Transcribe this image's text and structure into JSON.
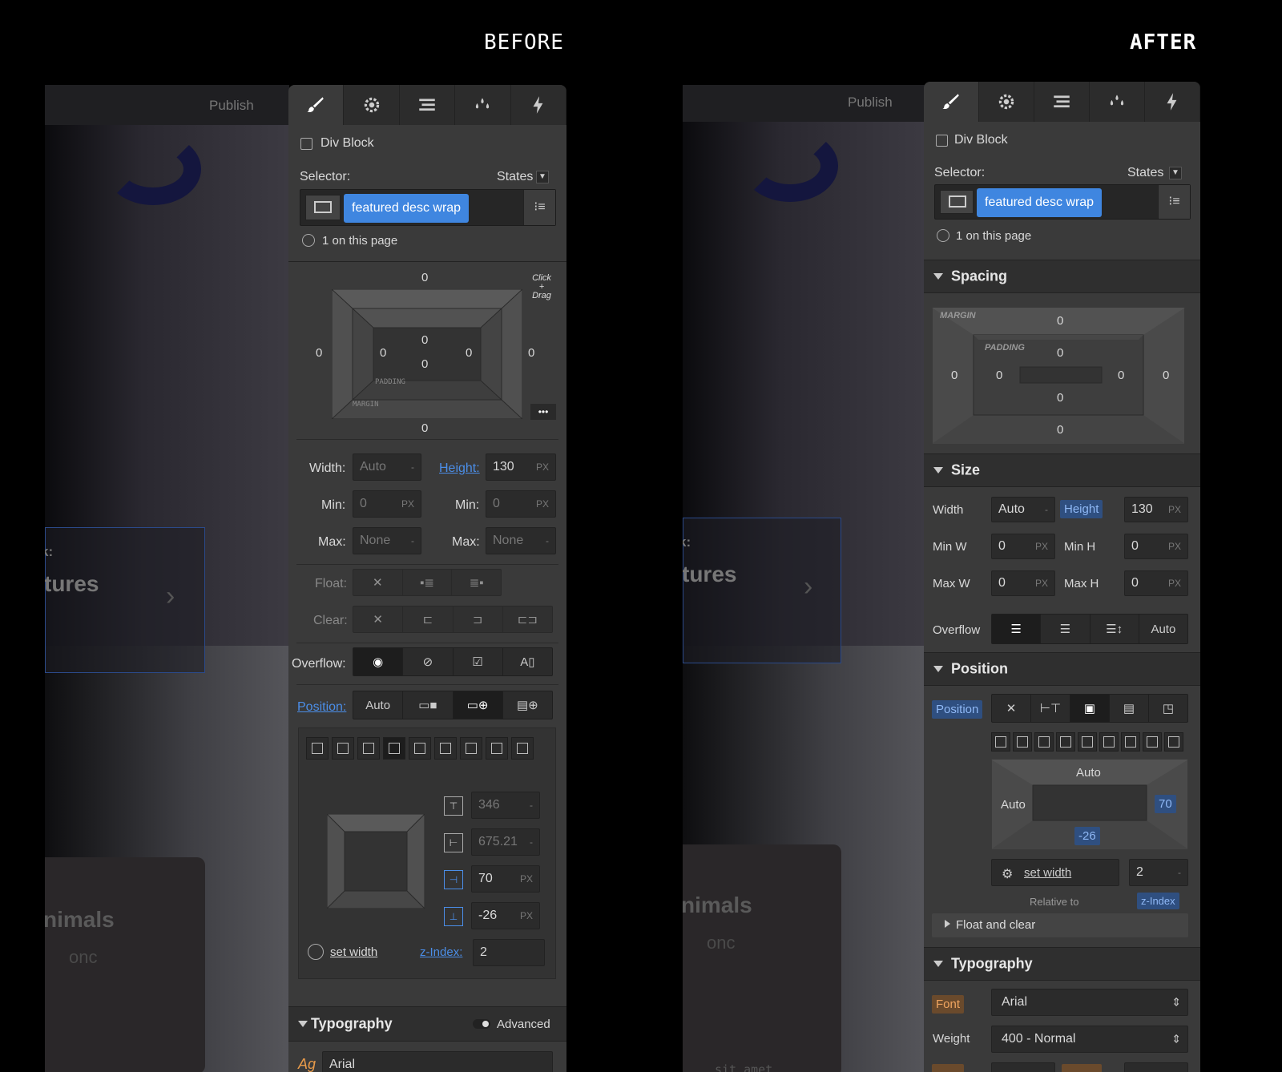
{
  "headings": {
    "before": "BEFORE",
    "after": "AFTER"
  },
  "canvas": {
    "publish": "Publish",
    "snippet1": "k:",
    "snippet2": "tures",
    "snippet3": "nimals",
    "snippet4": "onc",
    "snippet5": "sit amet"
  },
  "before": {
    "element": "Div Block",
    "selector_label": "Selector:",
    "states_label": "States",
    "class_chip": "featured desc wrap",
    "on_page": "1 on this page",
    "spacing": {
      "margin_top": "0",
      "margin_bottom": "0",
      "margin_left": "0",
      "margin_right": "0",
      "padding_top": "0",
      "padding_bottom": "0",
      "padding_left": "0",
      "padding_right": "0",
      "padding_label": "PADDING",
      "margin_label": "MARGIN",
      "hint": "Click + Drag"
    },
    "size": {
      "width_label": "Width:",
      "width_value": "Auto",
      "width_unit": "-",
      "height_label": "Height:",
      "height_value": "130",
      "height_unit": "PX",
      "min_label": "Min:",
      "min_w": "0",
      "min_w_unit": "PX",
      "min_h": "0",
      "min_h_unit": "PX",
      "max_label": "Max:",
      "max_w": "None",
      "max_w_unit": "-",
      "max_h": "None",
      "max_h_unit": "-"
    },
    "float_label": "Float:",
    "clear_label": "Clear:",
    "overflow_label": "Overflow:",
    "position_label": "Position:",
    "position_auto": "Auto",
    "offsets": {
      "top": "346",
      "top_unit": "-",
      "left": "675.21",
      "left_unit": "-",
      "right": "70",
      "right_unit": "PX",
      "bottom": "-26",
      "bottom_unit": "PX"
    },
    "set_width": "set width",
    "zindex_label": "z-Index:",
    "zindex_value": "2",
    "typography": "Typography",
    "advanced": "Advanced",
    "font_value": "Arial"
  },
  "after": {
    "element": "Div Block",
    "selector_label": "Selector:",
    "states_label": "States",
    "class_chip": "featured desc wrap",
    "on_page": "1 on this page",
    "spacing_section": "Spacing",
    "spacing": {
      "margin_label": "MARGIN",
      "padding_label": "PADDING",
      "margin_top": "0",
      "margin_bottom": "0",
      "margin_left": "0",
      "margin_right": "0",
      "padding_top": "0",
      "padding_bottom": "0",
      "padding_left": "0",
      "padding_right": "0"
    },
    "size_section": "Size",
    "size": {
      "width_label": "Width",
      "width_value": "Auto",
      "width_unit": "-",
      "height_label": "Height",
      "height_value": "130",
      "height_unit": "PX",
      "minw_label": "Min W",
      "minw_value": "0",
      "minw_unit": "PX",
      "minh_label": "Min H",
      "minh_value": "0",
      "minh_unit": "PX",
      "maxw_label": "Max W",
      "maxw_value": "0",
      "maxw_unit": "PX",
      "maxh_label": "Max H",
      "maxh_value": "0",
      "maxh_unit": "PX"
    },
    "overflow_label": "Overflow",
    "overflow_auto": "Auto",
    "position_section": "Position",
    "position_label": "Position",
    "offsets": {
      "top": "Auto",
      "left": "Auto",
      "right": "70",
      "bottom": "-26"
    },
    "set_width": "set width",
    "zindex_value": "2",
    "zindex_unit": "-",
    "relative_to": "Relative to",
    "zindex_label": "z-Index",
    "float_clear": "Float and clear",
    "typography_section": "Typography",
    "font_label": "Font",
    "font_value": "Arial",
    "weight_label": "Weight",
    "weight_value": "400 - Normal"
  }
}
